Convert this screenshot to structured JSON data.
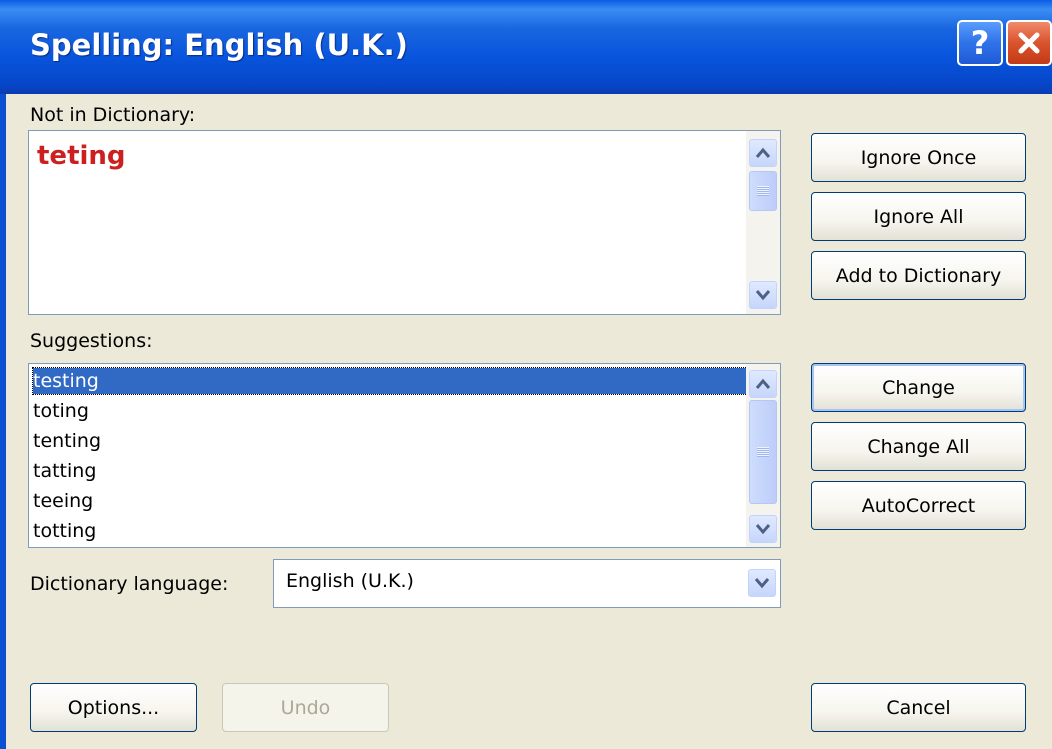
{
  "window": {
    "title": "Spelling: English (U.K.)",
    "help_symbol": "?",
    "close_symbol": "✕"
  },
  "not_in_dictionary": {
    "label": "Not in Dictionary:",
    "word": "teting",
    "word_color": "#cc1f1f"
  },
  "suggestions": {
    "label": "Suggestions:",
    "items": [
      "testing",
      "toting",
      "tenting",
      "tatting",
      "teeing",
      "totting"
    ],
    "selected_index": 0
  },
  "dictionary_language": {
    "label": "Dictionary language:",
    "value": "English (U.K.)"
  },
  "buttons": {
    "ignore_once": "Ignore Once",
    "ignore_all": "Ignore All",
    "add_to_dictionary": "Add to Dictionary",
    "change": "Change",
    "change_all": "Change All",
    "autocorrect": "AutoCorrect",
    "options": "Options...",
    "undo": "Undo",
    "cancel": "Cancel"
  },
  "icons": {
    "scroll_up": "chevron-up-icon",
    "scroll_down": "chevron-down-icon",
    "dropdown": "chevron-down-icon"
  },
  "colors": {
    "titlebar": "#0a5ee4",
    "selection": "#316ac5",
    "dialog_bg": "#ece9d8"
  }
}
